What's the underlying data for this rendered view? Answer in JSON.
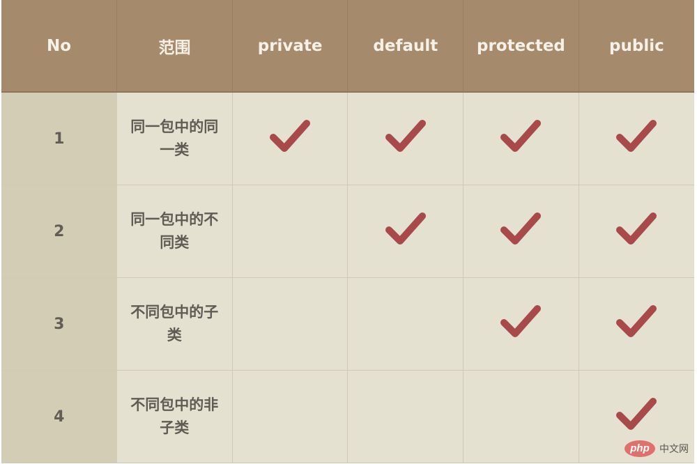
{
  "table": {
    "headers": [
      "No",
      "范围",
      "private",
      "default",
      "protected",
      "public"
    ],
    "rows": [
      {
        "no": "1",
        "scope": "同一包中的同一类",
        "private": true,
        "default": true,
        "protected": true,
        "public": true
      },
      {
        "no": "2",
        "scope": "同一包中的不同类",
        "private": false,
        "default": true,
        "protected": true,
        "public": true
      },
      {
        "no": "3",
        "scope": "不同包中的子类",
        "private": false,
        "default": false,
        "protected": true,
        "public": true
      },
      {
        "no": "4",
        "scope": "不同包中的非子类",
        "private": false,
        "default": false,
        "protected": false,
        "public": true
      }
    ],
    "check_icon": "checkmark-icon"
  },
  "colors": {
    "header_bg": "#a58a6c",
    "header_text": "#f6f1e6",
    "cell_bg": "#e5e1d0",
    "no_col_bg": "#d4cdb6",
    "check": "#a8494a"
  },
  "watermark": {
    "badge": "php",
    "text": "中文网"
  }
}
